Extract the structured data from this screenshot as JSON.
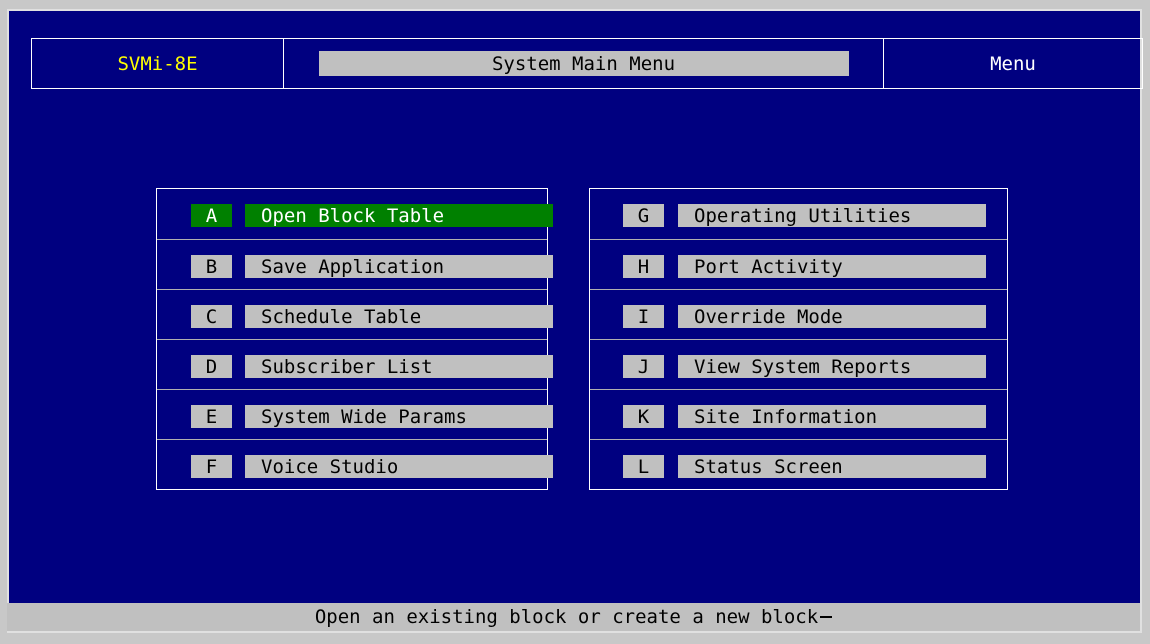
{
  "header": {
    "product": "SVMi-8E",
    "title": "System Main Menu",
    "mode": "Menu"
  },
  "menu": {
    "left": [
      {
        "key": "A",
        "label": "Open Block Table",
        "active": true
      },
      {
        "key": "B",
        "label": "Save Application"
      },
      {
        "key": "C",
        "label": "Schedule Table"
      },
      {
        "key": "D",
        "label": "Subscriber List"
      },
      {
        "key": "E",
        "label": "System Wide Params"
      },
      {
        "key": "F",
        "label": "Voice Studio"
      }
    ],
    "right": [
      {
        "key": "G",
        "label": "Operating Utilities"
      },
      {
        "key": "H",
        "label": "Port Activity"
      },
      {
        "key": "I",
        "label": "Override Mode"
      },
      {
        "key": "J",
        "label": "View System Reports"
      },
      {
        "key": "K",
        "label": "Site Information"
      },
      {
        "key": "L",
        "label": "Status Screen"
      }
    ]
  },
  "status": {
    "message": "Open an existing block or create a new block"
  },
  "colors": {
    "background": "#000080",
    "highlight": "#008000",
    "product_text": "#ffff00",
    "bar": "#c0c0c0"
  }
}
